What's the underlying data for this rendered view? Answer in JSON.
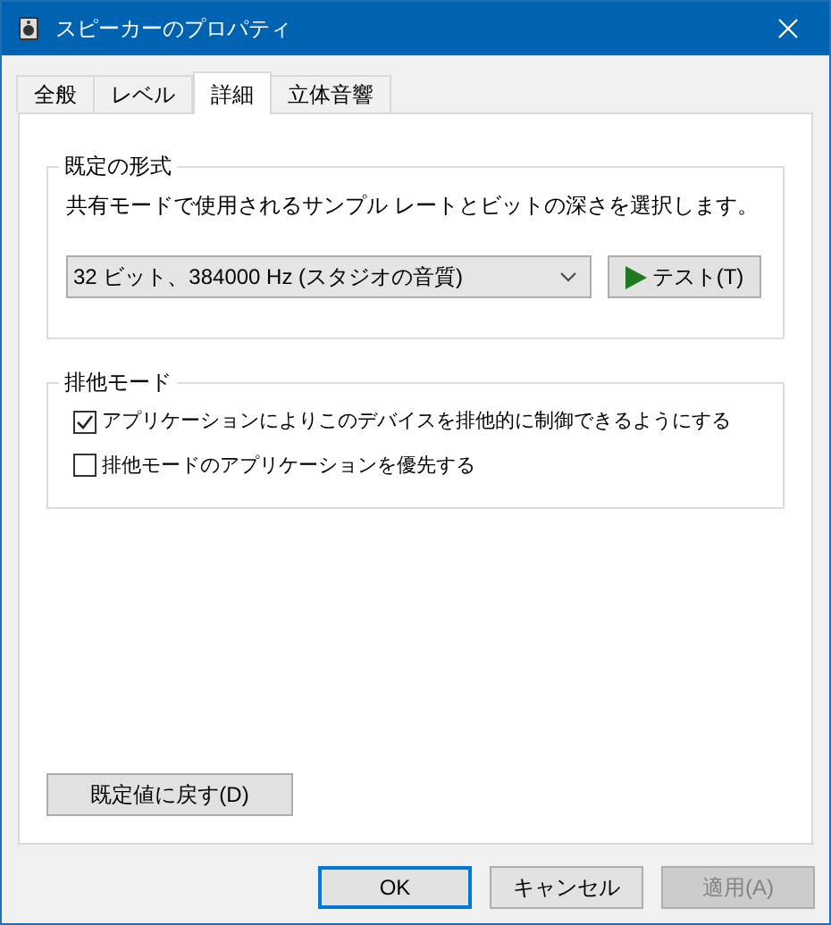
{
  "window": {
    "title": "スピーカーのプロパティ"
  },
  "tabs": [
    {
      "label": "全般",
      "selected": false
    },
    {
      "label": "レベル",
      "selected": false
    },
    {
      "label": "詳細",
      "selected": true
    },
    {
      "label": "立体音響",
      "selected": false
    }
  ],
  "default_format": {
    "legend": "既定の形式",
    "description": "共有モードで使用されるサンプル レートとビットの深さを選択します。",
    "format_select": {
      "value": "32 ビット、384000 Hz (スタジオの音質)"
    },
    "test_button": "テスト(T)"
  },
  "exclusive_mode": {
    "legend": "排他モード",
    "options": [
      {
        "label": "アプリケーションによりこのデバイスを排他的に制御できるようにする",
        "checked": true
      },
      {
        "label": "排他モードのアプリケーションを優先する",
        "checked": false
      }
    ]
  },
  "restore_defaults_button": "既定値に戻す(D)",
  "buttons": [
    {
      "label": "OK",
      "kind": "default",
      "disabled": false
    },
    {
      "label": "キャンセル",
      "kind": "normal",
      "disabled": false
    },
    {
      "label": "適用(A)",
      "kind": "normal",
      "disabled": true
    }
  ]
}
